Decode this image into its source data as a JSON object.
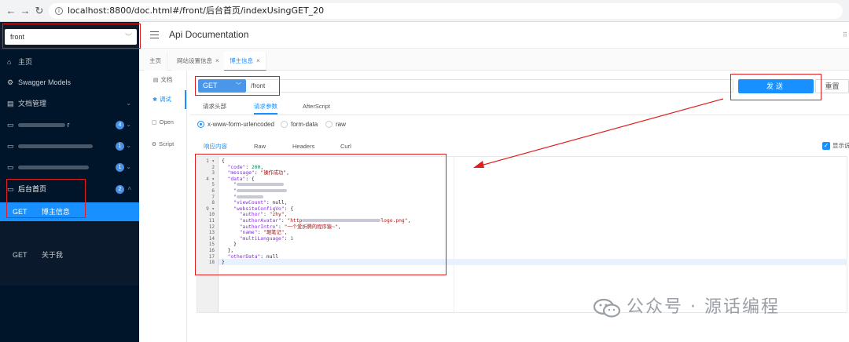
{
  "browser": {
    "url": "localhost:8800/doc.html#/front/后台首页/indexUsingGET_20",
    "nav": {
      "back": "←",
      "forward": "→",
      "reload": "↻"
    }
  },
  "sidebar": {
    "group_select": "front",
    "items": [
      {
        "label": "主页",
        "icon": "home-icon"
      },
      {
        "label": "Swagger Models",
        "icon": "model-icon"
      },
      {
        "label": "文档管理",
        "icon": "doc-manage-icon"
      },
      {
        "label": "r",
        "badge": "4"
      },
      {
        "label": "",
        "badge": "1"
      },
      {
        "label": "",
        "badge": "1"
      },
      {
        "label": "后台首页",
        "badge": "2"
      }
    ],
    "apis": [
      {
        "method": "GET",
        "name": "博主信息"
      },
      {
        "method": "GET",
        "name": "关于我"
      }
    ]
  },
  "header": {
    "title": "Api Documentation",
    "right_glyph": "⠿"
  },
  "tabs": [
    {
      "label": "主页"
    },
    {
      "label": "网站设置信息",
      "close": "×"
    },
    {
      "label": "博主信息",
      "close": "×"
    }
  ],
  "rail": [
    {
      "label": "文档",
      "icon": "doc-icon"
    },
    {
      "label": "调试",
      "icon": "debug-icon"
    },
    {
      "label": "Open",
      "icon": "open-icon"
    },
    {
      "label": "Script",
      "icon": "script-icon"
    }
  ],
  "request": {
    "method": "GET",
    "path": "/front",
    "send_label": "发送",
    "reset_label": "重置"
  },
  "param_tabs": [
    "请求头部",
    "请求参数",
    "AfterScript"
  ],
  "body_types": [
    "x-www-form-urlencoded",
    "form-data",
    "raw"
  ],
  "response_tabs": [
    "响应内容",
    "Raw",
    "Headers",
    "Curl"
  ],
  "show_desc_label": "显示说明",
  "code": {
    "line_numbers": [
      "1 ▾",
      "2",
      "3",
      "4 ▾",
      "5",
      "6",
      "7",
      "8",
      "9 ▾",
      "10",
      "11",
      "12",
      "13",
      "14",
      "15",
      "16",
      "17",
      "18"
    ],
    "lines": {
      "l1": "{",
      "l2k": "\"code\"",
      "l2v": "200",
      "l3k": "\"message\"",
      "l3v": "\"操作成功\"",
      "l4k": "\"data\"",
      "l5": "\"",
      "l6": "\"",
      "l7": "\"",
      "l8k": "\"viewCount\"",
      "l8v": "null",
      "l9k": "\"websiteConfigVo\"",
      "l10k": "\"author\"",
      "l10v": "\"zhy\"",
      "l11k": "\"authorAvatar\"",
      "l11v1": "\"http",
      "l11v2": "logo.png\"",
      "l12k": "\"authorIntro\"",
      "l12v": "\"一个爱折腾的程序猿~\"",
      "l13k": "\"name\"",
      "l13v": "\"琚笔记\"",
      "l14k": "\"multiLanguage\"",
      "l14v": "1",
      "l15": "}",
      "l16": "},",
      "l17k": "\"otherData\"",
      "l17v": "null",
      "l18": "}"
    }
  },
  "watermark": "公众号 · 源话编程",
  "colors": {
    "primary": "#1890ff",
    "sidebar_bg": "#001529",
    "annotation_red": "#e02020"
  }
}
